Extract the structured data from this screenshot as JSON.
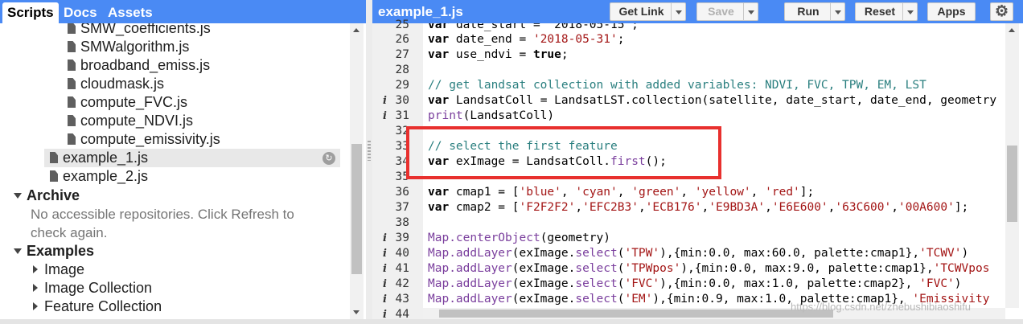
{
  "left_panel": {
    "tabs": [
      {
        "label": "Scripts",
        "active": true
      },
      {
        "label": "Docs",
        "active": false
      },
      {
        "label": "Assets",
        "active": false
      }
    ],
    "files_nested": [
      "SMW_coefficients.js",
      "SMWalgorithm.js",
      "broadband_emiss.js",
      "cloudmask.js",
      "compute_FVC.js",
      "compute_NDVI.js",
      "compute_emissivity.js"
    ],
    "files_top": [
      "example_1.js",
      "example_2.js"
    ],
    "selected_file": "example_1.js",
    "archive": {
      "label": "Archive",
      "message_line1": "No accessible repositories. Click Refresh to",
      "message_line2": "check again."
    },
    "examples": {
      "label": "Examples",
      "items": [
        "Image",
        "Image Collection",
        "Feature Collection"
      ]
    }
  },
  "editor": {
    "file_name": "example_1.js",
    "buttons": {
      "get_link": "Get Link",
      "save": "Save",
      "run": "Run",
      "reset": "Reset",
      "apps": "Apps"
    },
    "info_lines": [
      "30",
      "31",
      "39",
      "40",
      "41",
      "42",
      "43",
      "44"
    ],
    "line_numbers": [
      "25",
      "26",
      "27",
      "28",
      "29",
      "30",
      "31",
      "32",
      "33",
      "34",
      "35",
      "36",
      "37",
      "38",
      "39",
      "40",
      "41",
      "42",
      "43",
      "44"
    ],
    "code": {
      "l25_tail": "date_start = '2018-05-15';",
      "l26_var": "var",
      "l26_rest": " date_end = ",
      "l26_str": "'2018-05-31'",
      "l26_end": ";",
      "l27_var": "var",
      "l27_rest": " use_ndvi = ",
      "l27_true": "true",
      "l27_end": ";",
      "l29_comment": "// get landsat collection with added variables: NDVI, FVC, TPW, EM, LST",
      "l30_var": "var",
      "l30_rest": " LandsatColl = LandsatLST.collection(satellite, date_start, date_end, geometry",
      "l31_print": "print",
      "l31_rest": "(LandsatColl)",
      "l33_comment": "// select the first feature",
      "l34_var": "var",
      "l34_rest": " exImage = LandsatColl.",
      "l34_first": "first",
      "l34_end": "();",
      "l36_var": "var",
      "l36_a": " cmap1 = [",
      "l36_s1": "'blue'",
      "l36_s2": "'cyan'",
      "l36_s3": "'green'",
      "l36_s4": "'yellow'",
      "l36_s5": "'red'",
      "l36_end": "];",
      "l37_var": "var",
      "l37_a": " cmap2 = [",
      "l37_s1": "'F2F2F2'",
      "l37_s2": "'EFC2B3'",
      "l37_s3": "'ECB176'",
      "l37_s4": "'E9BD3A'",
      "l37_s5": "'E6E600'",
      "l37_s6": "'63C600'",
      "l37_s7": "'00A600'",
      "l37_end": "];",
      "l39_map": "Map.centerObject",
      "l39_rest": "(geometry)",
      "l40_map": "Map.addLayer",
      "l40_a": "(exImage.",
      "l40_sel": "select",
      "l40_b": "(",
      "l40_s": "'TPW'",
      "l40_c": "),{min:0.0, max:60.0, palette:cmap1},",
      "l40_s2": "'TCWV'",
      "l40_d": ")",
      "l41_map": "Map.addLayer",
      "l41_a": "(exImage.",
      "l41_sel": "select",
      "l41_b": "(",
      "l41_s": "'TPWpos'",
      "l41_c": "),{min:0.0, max:9.0, palette:cmap1},",
      "l41_s2": "'TCWVpos",
      "l42_map": "Map.addLayer",
      "l42_a": "(exImage.",
      "l42_sel": "select",
      "l42_b": "(",
      "l42_s": "'FVC'",
      "l42_c": "),{min:0.0, max:1.0, palette:cmap2}, ",
      "l42_s2": "'FVC'",
      "l42_d": ")",
      "l43_map": "Map.addLayer",
      "l43_a": "(exImage.",
      "l43_sel": "select",
      "l43_b": "(",
      "l43_s": "'EM'",
      "l43_c": "),{min:0.9, max:1.0, palette:cmap1}, ",
      "l43_s2": "'Emissivity"
    }
  },
  "watermark": "https://blog.csdn.net/zhebushibiaoshifu",
  "colors": {
    "header_blue": "#4a8af4",
    "highlight_red": "#e8302e",
    "comment": "#2a7f7f",
    "string": "#a31515",
    "function": "#7a3e9d"
  }
}
